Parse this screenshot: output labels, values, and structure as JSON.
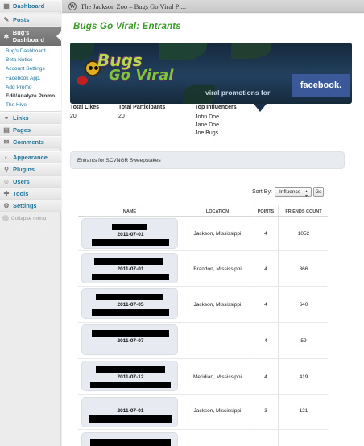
{
  "sidebar": {
    "items": [
      {
        "label": "Dashboard",
        "icon": "dashboard-icon"
      },
      {
        "label": "Posts",
        "icon": "pin-icon"
      },
      {
        "label": "Bug's Dashboard",
        "icon": "bug-icon"
      },
      {
        "label": "Links",
        "icon": "link-icon"
      },
      {
        "label": "Pages",
        "icon": "page-icon"
      },
      {
        "label": "Comments",
        "icon": "comment-icon"
      },
      {
        "label": "Appearance",
        "icon": "appearance-icon"
      },
      {
        "label": "Plugins",
        "icon": "plugin-icon"
      },
      {
        "label": "Users",
        "icon": "users-icon"
      },
      {
        "label": "Tools",
        "icon": "tools-icon"
      },
      {
        "label": "Settings",
        "icon": "settings-icon"
      }
    ],
    "submenu": [
      "Bug's Dashboard",
      "Beta Notice",
      "Account Settings",
      "Facebook App.",
      "Add Promo",
      "Edit/Analyze Promo",
      "The Hive"
    ],
    "collapse_label": "Collapse menu"
  },
  "header": {
    "site_title": "The Jackson Zoo – Bugs Go Viral Pr..."
  },
  "page": {
    "title": "Bugs Go Viral: Entrants"
  },
  "banner": {
    "logo_line1": "Bugs",
    "logo_line2": "Go Viral",
    "tagline": "viral promotions for",
    "facebook": "facebook."
  },
  "stats": {
    "total_likes_label": "Total Likes",
    "total_likes": "20",
    "total_participants_label": "Total Participants",
    "total_participants": "20",
    "top_influencers_label": "Top Influencers",
    "top_influencers": [
      "John Doe",
      "Jane Doe",
      "Joe Bugs"
    ]
  },
  "entrants_box": "Entrants for SCVNGR Sweepstakes",
  "sort": {
    "label": "Sort By:",
    "selected": "Influence",
    "go": "Go"
  },
  "table": {
    "headers": [
      "NAME",
      "LOCATION",
      "POINTS",
      "FRIENDS COUNT"
    ],
    "rows": [
      {
        "date": "2011-07-01",
        "location": "Jackson, Mississippi",
        "points": "4",
        "friends": "1052"
      },
      {
        "date": "2011-07-01",
        "location": "Brandon, Mississippi",
        "points": "4",
        "friends": "366"
      },
      {
        "date": "2011-07-05",
        "location": "Jackson, Mississippi",
        "points": "4",
        "friends": "640"
      },
      {
        "date": "2011-07-07",
        "location": "",
        "points": "4",
        "friends": "59"
      },
      {
        "date": "2011-07-12",
        "location": "Meridian, Mississippi",
        "points": "4",
        "friends": "419"
      },
      {
        "date": "2011-07-01",
        "location": "Jackson, Mississippi",
        "points": "3",
        "friends": "121"
      }
    ]
  },
  "colors": {
    "link": "#21759b",
    "title_green": "#3a9b27",
    "facebook_blue": "#3b5998"
  }
}
